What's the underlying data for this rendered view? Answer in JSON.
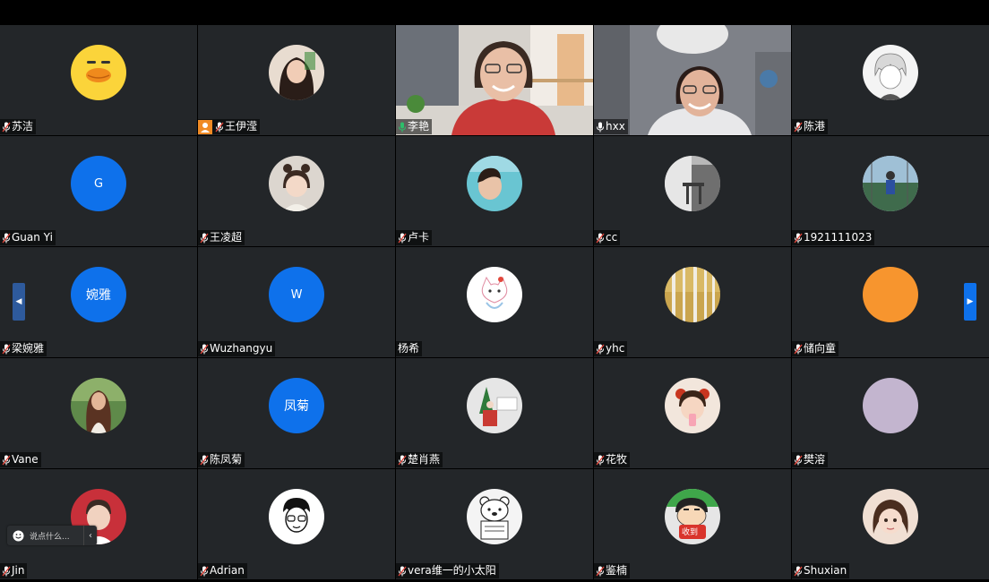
{
  "participants": [
    {
      "name": "苏洁",
      "mic": "muted",
      "avatar": {
        "kind": "image",
        "icon": "cartoon-duck-avatar-icon",
        "color": "#fbd43a"
      }
    },
    {
      "name": "王伊滢",
      "mic": "muted",
      "host": true,
      "avatar": {
        "kind": "image",
        "icon": "girl-photo-avatar-icon",
        "color": "#7b5b4b"
      }
    },
    {
      "name": "李艳",
      "mic": "unmuted-active",
      "speaking": true,
      "avatar": {
        "kind": "video",
        "icon": "webcam-video-woman-icon",
        "color": "#d9a892"
      }
    },
    {
      "name": "hxx",
      "mic": "unmuted",
      "avatar": {
        "kind": "video",
        "icon": "webcam-video-woman-glasses-icon",
        "color": "#8c8f96"
      }
    },
    {
      "name": "陈港",
      "mic": "muted",
      "avatar": {
        "kind": "image",
        "icon": "anime-boy-avatar-icon",
        "color": "#e8e8e8"
      }
    },
    {
      "name": "Guan Yi",
      "mic": "muted",
      "avatar": {
        "kind": "letter",
        "letter": "G",
        "color": "#0e71eb"
      }
    },
    {
      "name": "王凌超",
      "mic": "muted",
      "avatar": {
        "kind": "image",
        "icon": "child-photo-avatar-icon",
        "color": "#cfc9c2"
      }
    },
    {
      "name": "卢卡",
      "mic": "muted",
      "avatar": {
        "kind": "image",
        "icon": "woman-pool-avatar-icon",
        "color": "#4fb6c4"
      }
    },
    {
      "name": "cc",
      "mic": "muted",
      "avatar": {
        "kind": "image",
        "icon": "bw-photo-avatar-icon",
        "color": "#9a9a9a"
      }
    },
    {
      "name": "1921111023",
      "mic": "muted",
      "avatar": {
        "kind": "image",
        "icon": "sports-photo-avatar-icon",
        "color": "#6a8a7a"
      }
    },
    {
      "name": "梁婉雅",
      "mic": "muted",
      "avatar": {
        "kind": "letter",
        "letter": "婉雅",
        "color": "#0e71eb"
      }
    },
    {
      "name": "Wuzhangyu",
      "mic": "muted",
      "avatar": {
        "kind": "letter",
        "letter": "W",
        "color": "#0e71eb"
      }
    },
    {
      "name": "杨希",
      "mic": "none",
      "avatar": {
        "kind": "image",
        "icon": "cartoon-cat-avatar-icon",
        "color": "#ffffff"
      }
    },
    {
      "name": "yhc",
      "mic": "muted",
      "avatar": {
        "kind": "image",
        "icon": "birch-forest-avatar-icon",
        "color": "#b89a52"
      }
    },
    {
      "name": "储向童",
      "mic": "muted",
      "avatar": {
        "kind": "plain",
        "icon": "orange-circle-avatar-icon",
        "color": "#f7952e"
      }
    },
    {
      "name": "Vane",
      "mic": "muted",
      "avatar": {
        "kind": "image",
        "icon": "woman-outdoor-avatar-icon",
        "color": "#4f7a3e"
      }
    },
    {
      "name": "陈凤菊",
      "mic": "muted",
      "avatar": {
        "kind": "letter",
        "letter": "凤菊",
        "color": "#0e71eb"
      }
    },
    {
      "name": "楚肖燕",
      "mic": "muted",
      "avatar": {
        "kind": "image",
        "icon": "christmas-photo-avatar-icon",
        "color": "#c94a3f"
      }
    },
    {
      "name": "花牧",
      "mic": "muted",
      "avatar": {
        "kind": "image",
        "icon": "baby-photo-avatar-icon",
        "color": "#e8c6b4"
      }
    },
    {
      "name": "樊溶",
      "mic": "muted",
      "avatar": {
        "kind": "plain",
        "icon": "lavender-circle-avatar-icon",
        "color": "#c3b5cf"
      }
    },
    {
      "name": "Jin",
      "mic": "muted",
      "avatar": {
        "kind": "image",
        "icon": "boy-red-avatar-icon",
        "color": "#c8303a"
      }
    },
    {
      "name": "Adrian",
      "mic": "muted",
      "avatar": {
        "kind": "image",
        "icon": "sketch-face-avatar-icon",
        "color": "#ffffff"
      }
    },
    {
      "name": "vera维一的小太阳",
      "mic": "muted",
      "avatar": {
        "kind": "image",
        "icon": "polar-bear-avatar-icon",
        "color": "#f2f2f2"
      }
    },
    {
      "name": "鉴楠",
      "mic": "muted",
      "avatar": {
        "kind": "image",
        "icon": "crayon-shin-avatar-icon",
        "color": "#f4d28a",
        "badge": "收到"
      }
    },
    {
      "name": "Shuxian",
      "mic": "muted",
      "avatar": {
        "kind": "image",
        "icon": "doll-girl-avatar-icon",
        "color": "#e9d4c6"
      }
    }
  ],
  "chat": {
    "placeholder": "说点什么...",
    "emoji_icon": "smiley-icon",
    "collapse_icon": "chevron-left-icon"
  },
  "navigation": {
    "prev_icon": "chevron-left-icon",
    "next_icon": "chevron-right-icon"
  },
  "colors": {
    "tile_background": "#232629",
    "accent_blue": "#0e71eb",
    "speaking_green": "#2dbf6a",
    "muted_red": "#e0443a"
  }
}
